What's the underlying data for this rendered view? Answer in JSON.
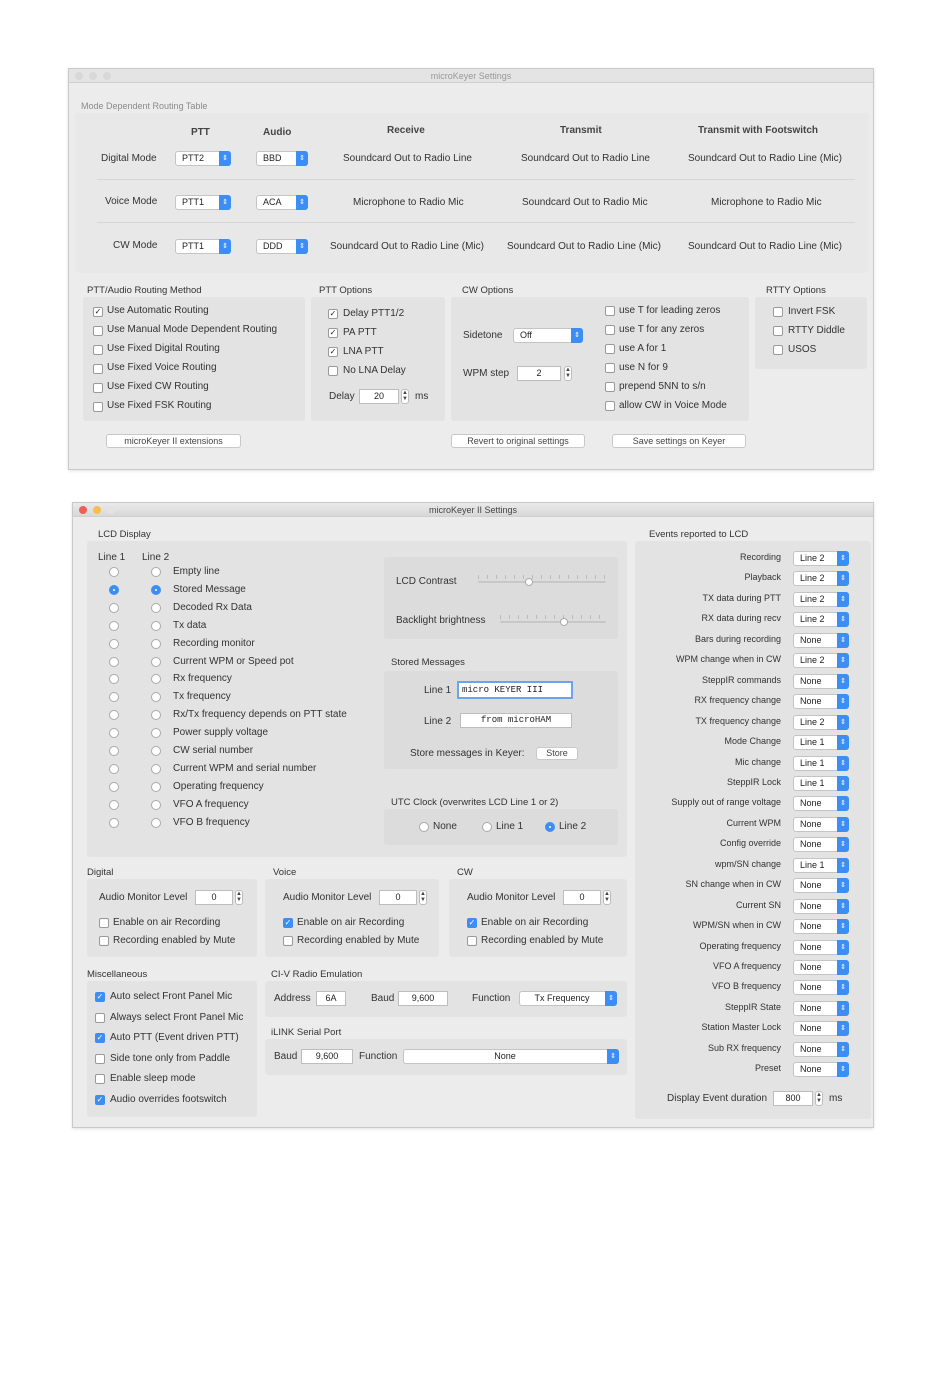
{
  "win1": {
    "title": "microKeyer Settings",
    "table_title": "Mode Dependent Routing Table",
    "headers": {
      "ptt": "PTT",
      "audio": "Audio",
      "receive": "Receive",
      "transmit": "Transmit",
      "footswitch": "Transmit with Footswitch"
    },
    "rows": [
      {
        "mode": "Digital Mode",
        "ptt": "PTT2",
        "audio": "BBD",
        "receive": "Soundcard Out to Radio Line",
        "transmit": "Soundcard Out to Radio Line",
        "footswitch": "Soundcard Out to Radio Line (Mic)"
      },
      {
        "mode": "Voice Mode",
        "ptt": "PTT1",
        "audio": "ACA",
        "receive": "Microphone to Radio Mic",
        "transmit": "Soundcard Out to Radio Mic",
        "footswitch": "Microphone to Radio Mic"
      },
      {
        "mode": "CW Mode",
        "ptt": "PTT1",
        "audio": "DDD",
        "receive": "Soundcard Out to Radio Line (Mic)",
        "transmit": "Soundcard Out to Radio Line (Mic)",
        "footswitch": "Soundcard Out to Radio Line (Mic)"
      }
    ],
    "routing_method": {
      "title": "PTT/Audio Routing Method",
      "items": [
        {
          "label": "Use Automatic Routing",
          "checked": true
        },
        {
          "label": "Use Manual Mode Dependent Routing",
          "checked": false
        },
        {
          "label": "Use Fixed Digital Routing",
          "checked": false
        },
        {
          "label": "Use Fixed Voice Routing",
          "checked": false
        },
        {
          "label": "Use Fixed CW Routing",
          "checked": false
        },
        {
          "label": "Use Fixed FSK Routing",
          "checked": false
        }
      ]
    },
    "ptt_options": {
      "title": "PTT Options",
      "items": [
        {
          "label": "Delay PTT1/2",
          "checked": true
        },
        {
          "label": "PA PTT",
          "checked": true
        },
        {
          "label": "LNA PTT",
          "checked": true
        },
        {
          "label": "No LNA Delay",
          "checked": false
        }
      ],
      "delay_label": "Delay",
      "delay_value": "20",
      "delay_unit": "ms"
    },
    "cw_options": {
      "title": "CW Options",
      "sidetone_label": "Sidetone",
      "sidetone_value": "Off",
      "wpm_label": "WPM step",
      "wpm_value": "2",
      "items": [
        {
          "label": "use T for leading zeros",
          "checked": false
        },
        {
          "label": "use T for any zeros",
          "checked": false
        },
        {
          "label": "use A for 1",
          "checked": false
        },
        {
          "label": "use N for 9",
          "checked": false
        },
        {
          "label": "prepend 5NN to s/n",
          "checked": false
        },
        {
          "label": "allow CW in Voice Mode",
          "checked": false
        }
      ]
    },
    "rtty_options": {
      "title": "RTTY Options",
      "items": [
        {
          "label": "Invert FSK",
          "checked": false
        },
        {
          "label": "RTTY Diddle",
          "checked": false
        },
        {
          "label": "USOS",
          "checked": false
        }
      ]
    },
    "buttons": {
      "extensions": "microKeyer II extensions",
      "revert": "Revert to original settings",
      "save": "Save settings on Keyer"
    }
  },
  "win2": {
    "title": "microKeyer II Settings",
    "lcd": {
      "title": "LCD Display",
      "col1": "Line 1",
      "col2": "Line 2",
      "options": [
        {
          "label": "Empty line",
          "l1": false,
          "l2": false
        },
        {
          "label": "Stored Message",
          "l1": true,
          "l2": true
        },
        {
          "label": "Decoded Rx Data",
          "l1": false,
          "l2": false
        },
        {
          "label": "Tx data",
          "l1": false,
          "l2": false
        },
        {
          "label": "Recording monitor",
          "l1": false,
          "l2": false
        },
        {
          "label": "Current WPM or Speed pot",
          "l1": false,
          "l2": false
        },
        {
          "label": "Rx frequency",
          "l1": false,
          "l2": false
        },
        {
          "label": "Tx frequency",
          "l1": false,
          "l2": false
        },
        {
          "label": "Rx/Tx frequency depends on PTT state",
          "l1": false,
          "l2": false
        },
        {
          "label": "Power supply voltage",
          "l1": false,
          "l2": false
        },
        {
          "label": "CW serial number",
          "l1": false,
          "l2": false
        },
        {
          "label": "Current WPM and serial number",
          "l1": false,
          "l2": false
        },
        {
          "label": "Operating frequency",
          "l1": false,
          "l2": false
        },
        {
          "label": "VFO A frequency",
          "l1": false,
          "l2": false
        },
        {
          "label": "VFO B frequency",
          "l1": false,
          "l2": false
        }
      ],
      "contrast_label": "LCD Contrast",
      "contrast_level": 0.4,
      "backlight_label": "Backlight brightness",
      "backlight_level": 0.6,
      "stored_title": "Stored Messages",
      "line1_label": "Line 1",
      "line1_value": "micro KEYER III",
      "line2_label": "Line 2",
      "line2_value": "from microHAM",
      "store_label": "Store messages in Keyer:",
      "store_btn": "Store",
      "utc_title": "UTC Clock (overwrites LCD Line 1 or 2)",
      "utc_none": "None",
      "utc_line1": "Line 1",
      "utc_line2": "Line 2",
      "utc_selected": "Line 2"
    },
    "digital": {
      "title": "Digital",
      "level_label": "Audio Monitor Level",
      "level": "0",
      "enable": "Enable on air Recording",
      "enable_checked": false,
      "mute": "Recording enabled by Mute",
      "mute_checked": false
    },
    "voice": {
      "title": "Voice",
      "level_label": "Audio Monitor Level",
      "level": "0",
      "enable": "Enable on air Recording",
      "enable_checked": true,
      "mute": "Recording enabled by Mute",
      "mute_checked": false
    },
    "cw": {
      "title": "CW",
      "level_label": "Audio Monitor Level",
      "level": "0",
      "enable": "Enable on air Recording",
      "enable_checked": true,
      "mute": "Recording enabled by Mute",
      "mute_checked": false
    },
    "misc": {
      "title": "Miscellaneous",
      "items": [
        {
          "label": "Auto select Front Panel Mic",
          "checked": true
        },
        {
          "label": "Always select Front Panel Mic",
          "checked": false
        },
        {
          "label": "Auto PTT (Event driven PTT)",
          "checked": true
        },
        {
          "label": "Side tone only from Paddle",
          "checked": false
        },
        {
          "label": "Enable sleep mode",
          "checked": false
        },
        {
          "label": "Audio overrides footswitch",
          "checked": true
        }
      ]
    },
    "civ": {
      "title": "CI-V Radio Emulation",
      "address_label": "Address",
      "address": "6A",
      "baud_label": "Baud",
      "baud": "9,600",
      "function_label": "Function",
      "function": "Tx Frequency"
    },
    "ilink": {
      "title": "iLINK Serial Port",
      "baud_label": "Baud",
      "baud": "9,600",
      "function_label": "Function",
      "function": "None"
    },
    "events": {
      "title": "Events reported to LCD",
      "items": [
        {
          "label": "Recording",
          "value": "Line 2"
        },
        {
          "label": "Playback",
          "value": "Line 2"
        },
        {
          "label": "TX data during PTT",
          "value": "Line 2"
        },
        {
          "label": "RX data during recv",
          "value": "Line 2"
        },
        {
          "label": "Bars during recording",
          "value": "None"
        },
        {
          "label": "WPM change when in CW",
          "value": "Line 2"
        },
        {
          "label": "SteppIR commands",
          "value": "None"
        },
        {
          "label": "RX frequency change",
          "value": "None"
        },
        {
          "label": "TX frequency change",
          "value": "Line 2"
        },
        {
          "label": "Mode Change",
          "value": "Line 1"
        },
        {
          "label": "Mic change",
          "value": "Line 1"
        },
        {
          "label": "SteppIR Lock",
          "value": "Line 1"
        },
        {
          "label": "Supply out of range voltage",
          "value": "None"
        },
        {
          "label": "Current WPM",
          "value": "None"
        },
        {
          "label": "Config override",
          "value": "None"
        },
        {
          "label": "wpm/SN change",
          "value": "Line 1"
        },
        {
          "label": "SN change when in CW",
          "value": "None"
        },
        {
          "label": "Current SN",
          "value": "None"
        },
        {
          "label": "WPM/SN when in CW",
          "value": "None"
        },
        {
          "label": "Operating frequency",
          "value": "None"
        },
        {
          "label": "VFO A frequency",
          "value": "None"
        },
        {
          "label": "VFO B frequency",
          "value": "None"
        },
        {
          "label": "SteppIR State",
          "value": "None"
        },
        {
          "label": "Station Master Lock",
          "value": "None"
        },
        {
          "label": "Sub RX frequency",
          "value": "None"
        },
        {
          "label": "Preset",
          "value": "None"
        }
      ],
      "duration_label": "Display Event duration",
      "duration": "800",
      "duration_unit": "ms"
    }
  }
}
